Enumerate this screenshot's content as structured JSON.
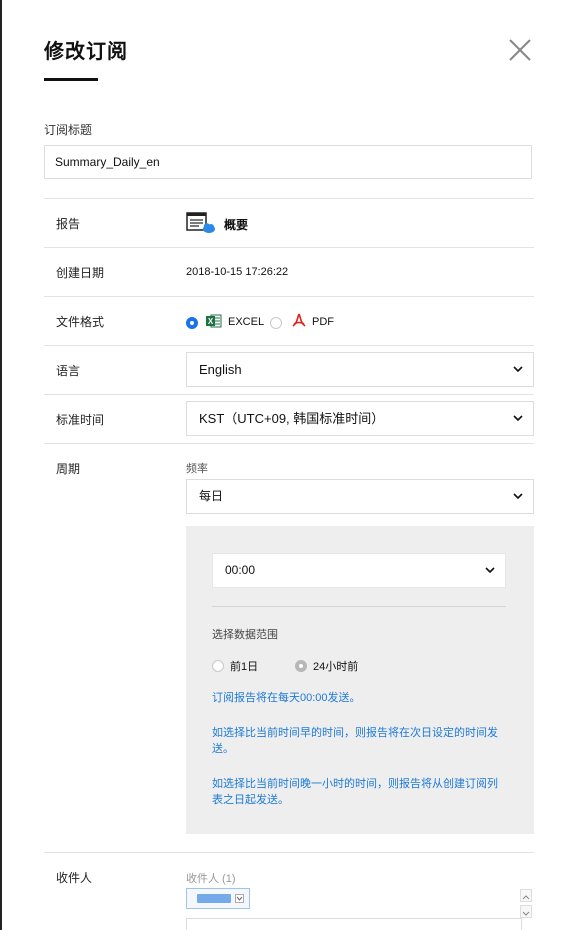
{
  "dialog": {
    "title": "修改订阅"
  },
  "subscription_title": {
    "label": "订阅标题",
    "value": "Summary_Daily_en"
  },
  "report": {
    "label": "报告",
    "name": "概要",
    "icon": "report-cloud-icon"
  },
  "created_date": {
    "label": "创建日期",
    "value": "2018-10-15 17:26:22"
  },
  "file_format": {
    "label": "文件格式",
    "options": [
      {
        "label": "EXCEL",
        "selected": true,
        "icon": "excel-icon"
      },
      {
        "label": "PDF",
        "selected": false,
        "icon": "pdf-icon"
      }
    ]
  },
  "language": {
    "label": "语言",
    "value": "English"
  },
  "timezone": {
    "label": "标准时间",
    "value": "KST（UTC+09, 韩国标准时间）"
  },
  "cycle": {
    "label": "周期",
    "frequency_label": "频率",
    "frequency_value": "每日",
    "time_value": "00:00",
    "range_label": "选择数据范围",
    "range_options": [
      {
        "label": "前1日",
        "selected": false
      },
      {
        "label": "24小时前",
        "selected": true
      }
    ],
    "info_1": "订阅报告将在每天00:00发送。",
    "info_2": "如选择比当前时间早的时间，则报告将在次日设定的时间发送。",
    "info_3": "如选择比当前时间晚一小时的时间，则报告将从创建订阅列表之日起发送。"
  },
  "recipients": {
    "label": "收件人",
    "count_label": "收件人 (1)"
  },
  "colors": {
    "accent": "#1a73e8",
    "info_text": "#1e7ad6",
    "panel_bg": "#eeeeee",
    "excel_green": "#1e7145",
    "pdf_red": "#d9251c"
  }
}
